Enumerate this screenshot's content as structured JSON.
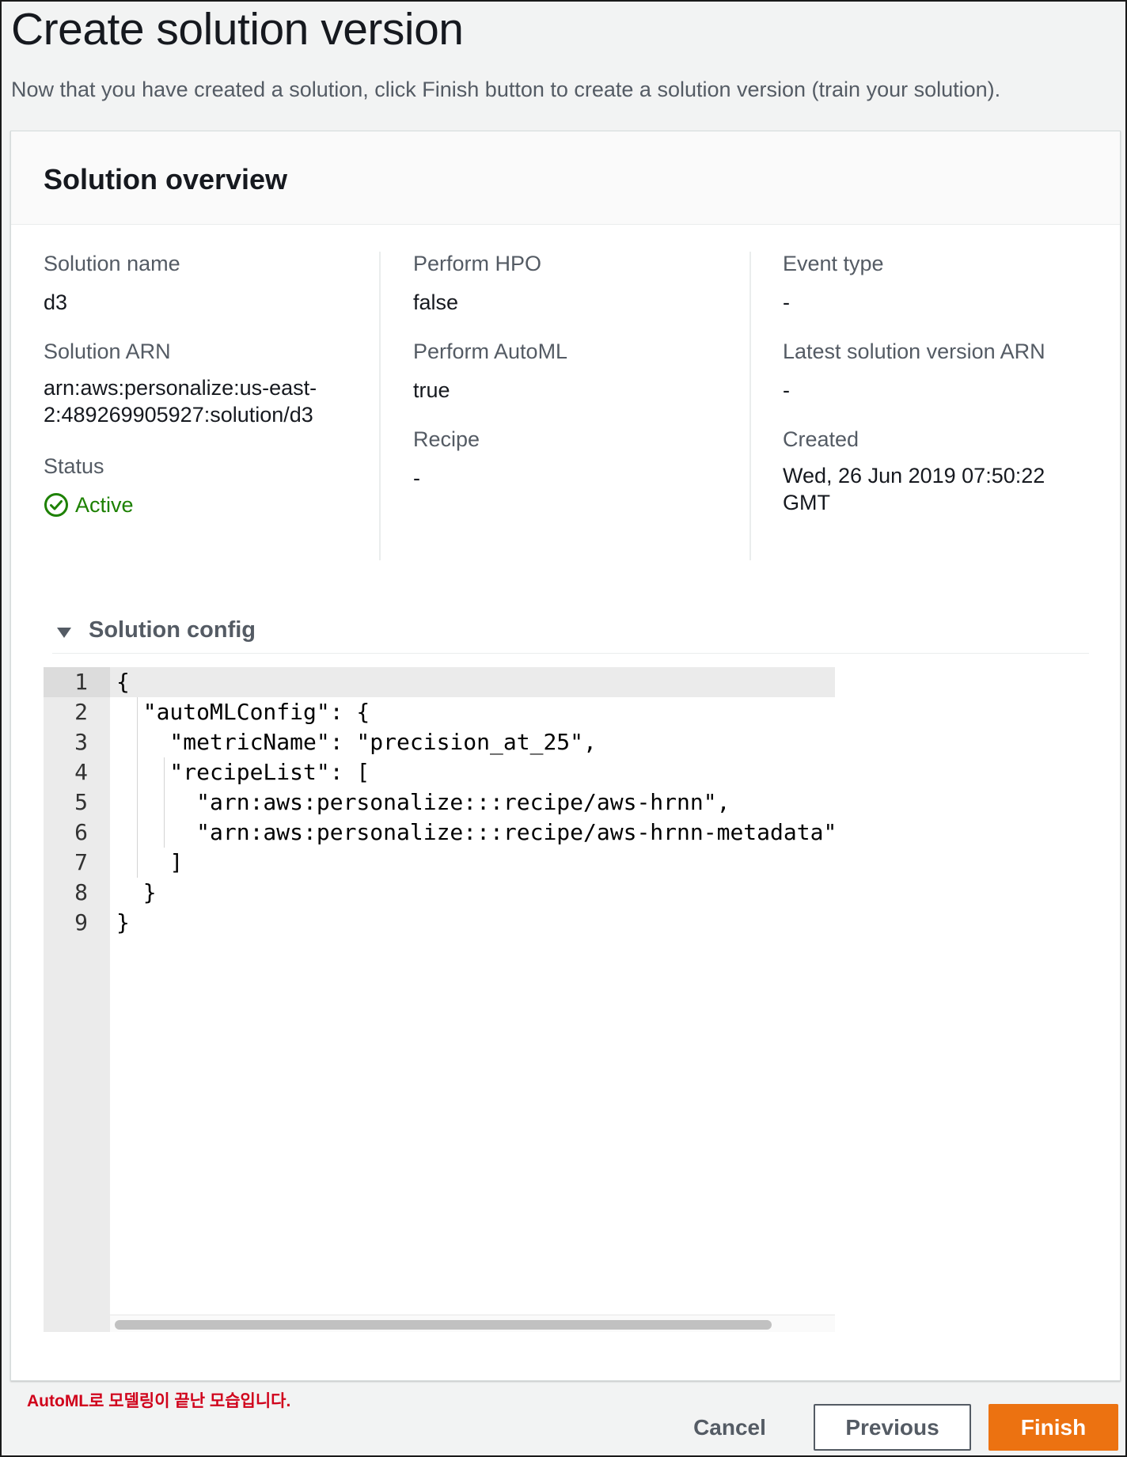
{
  "page": {
    "title": "Create solution version",
    "description": "Now that you have created a solution, click Finish button to create a solution version (train your solution)."
  },
  "overview": {
    "title": "Solution overview",
    "solution_name": {
      "label": "Solution name",
      "value": "d3"
    },
    "solution_arn": {
      "label": "Solution ARN",
      "value_line1": "arn:aws:personalize:us-east-",
      "value_line2": "2:489269905927:solution/d3"
    },
    "status": {
      "label": "Status",
      "value": "Active",
      "icon": "check-circle-icon",
      "color": "#1d8102"
    },
    "perform_hpo": {
      "label": "Perform HPO",
      "value": "false"
    },
    "perform_automl": {
      "label": "Perform AutoML",
      "value": "true"
    },
    "recipe": {
      "label": "Recipe",
      "value": "-"
    },
    "event_type": {
      "label": "Event type",
      "value": "-"
    },
    "latest_version_arn": {
      "label": "Latest solution version ARN",
      "value": "-"
    },
    "created": {
      "label": "Created",
      "value_line1": "Wed, 26 Jun 2019 07:50:22",
      "value_line2": "GMT"
    }
  },
  "config": {
    "label": "Solution config",
    "expanded": true,
    "line_numbers": [
      "1",
      "2",
      "3",
      "4",
      "5",
      "6",
      "7",
      "8",
      "9"
    ],
    "lines": [
      "{",
      "  \"autoMLConfig\": {",
      "    \"metricName\": \"precision_at_25\",",
      "    \"recipeList\": [",
      "      \"arn:aws:personalize:::recipe/aws-hrnn\",",
      "      \"arn:aws:personalize:::recipe/aws-hrnn-metadata\"",
      "    ]",
      "  }",
      "}"
    ]
  },
  "annotation": "AutoML로 모델링이 끝난 모습입니다.",
  "buttons": {
    "cancel": "Cancel",
    "previous": "Previous",
    "finish": "Finish"
  },
  "colors": {
    "accent": "#ec7211",
    "success": "#1d8102",
    "annotation": "#d0021b"
  }
}
